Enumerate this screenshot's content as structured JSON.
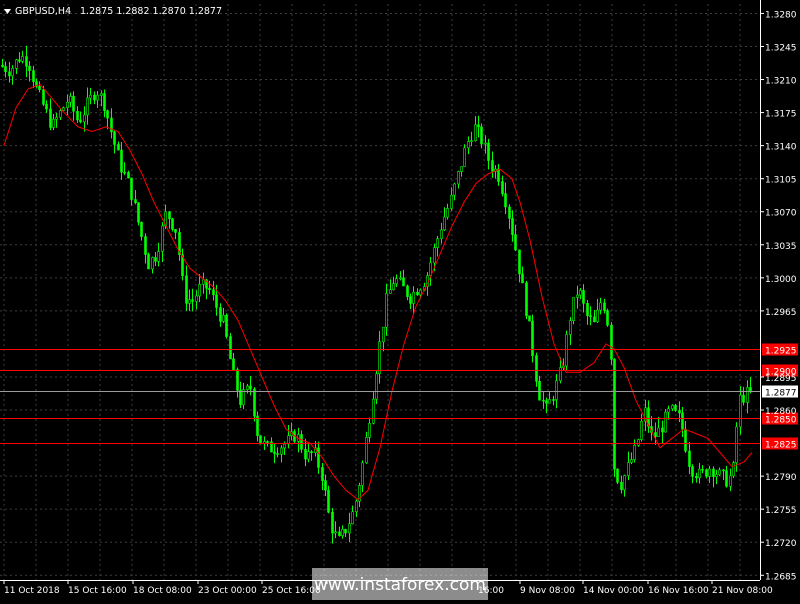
{
  "header": {
    "symbol": "GBPUSD,H4",
    "ohlc": "1.2875 1.2882 1.2870 1.2877"
  },
  "watermark": "www.instaforex.com",
  "colors": {
    "background": "#000000",
    "candle": "#00ff00",
    "ma": "#ff0000",
    "level": "#ff0000",
    "grid": "#3c3c3c",
    "axis": "#ffffff",
    "price_label_bg": "#ffffff",
    "level_label_bg": "#ff0000"
  },
  "chart_data": {
    "type": "candlestick",
    "y_ticks": [
      "1.3280",
      "1.3245",
      "1.3210",
      "1.3175",
      "1.3140",
      "1.3105",
      "1.3070",
      "1.3035",
      "1.3000",
      "1.2965",
      "1.2895",
      "1.2860",
      "1.2790",
      "1.2755",
      "1.2720",
      "1.2685"
    ],
    "ylim": [
      1.268,
      1.329
    ],
    "x_labels": [
      "11 Oct 2018",
      "15 Oct 16:00",
      "18 Oct 08:00",
      "23 Oct 00:00",
      "25 Oct 16:00",
      "16:00",
      "9 Nov 08:00",
      "14 Nov 00:00",
      "16 Nov 16:00",
      "21 Nov 08:00"
    ],
    "close_path": [
      [
        0,
        1.3225
      ],
      [
        10,
        1.322
      ],
      [
        20,
        1.3235
      ],
      [
        28,
        1.323
      ],
      [
        36,
        1.32
      ],
      [
        44,
        1.318
      ],
      [
        52,
        1.316
      ],
      [
        60,
        1.3175
      ],
      [
        68,
        1.319
      ],
      [
        78,
        1.3165
      ],
      [
        88,
        1.3185
      ],
      [
        96,
        1.32
      ],
      [
        104,
        1.3185
      ],
      [
        112,
        1.315
      ],
      [
        120,
        1.312
      ],
      [
        130,
        1.3095
      ],
      [
        140,
        1.305
      ],
      [
        148,
        1.3015
      ],
      [
        156,
        1.3025
      ],
      [
        166,
        1.307
      ],
      [
        176,
        1.305
      ],
      [
        184,
        1.298
      ],
      [
        192,
        1.2975
      ],
      [
        200,
        1.299
      ],
      [
        208,
        1.299
      ],
      [
        216,
        1.297
      ],
      [
        224,
        1.295
      ],
      [
        232,
        1.29
      ],
      [
        240,
        1.287
      ],
      [
        250,
        1.2885
      ],
      [
        258,
        1.283
      ],
      [
        266,
        1.282
      ],
      [
        276,
        1.282
      ],
      [
        286,
        1.2825
      ],
      [
        296,
        1.2835
      ],
      [
        306,
        1.281
      ],
      [
        314,
        1.2815
      ],
      [
        322,
        1.279
      ],
      [
        330,
        1.274
      ],
      [
        338,
        1.272
      ],
      [
        346,
        1.2735
      ],
      [
        354,
        1.2755
      ],
      [
        362,
        1.28
      ],
      [
        370,
        1.286
      ],
      [
        378,
        1.292
      ],
      [
        386,
        1.2975
      ],
      [
        394,
        1.3
      ],
      [
        402,
        1.299
      ],
      [
        410,
        1.298
      ],
      [
        418,
        1.299
      ],
      [
        426,
        1.3
      ],
      [
        434,
        1.303
      ],
      [
        442,
        1.306
      ],
      [
        450,
        1.308
      ],
      [
        458,
        1.311
      ],
      [
        466,
        1.314
      ],
      [
        474,
        1.316
      ],
      [
        482,
        1.3145
      ],
      [
        490,
        1.312
      ],
      [
        498,
        1.311
      ],
      [
        506,
        1.308
      ],
      [
        514,
        1.304
      ],
      [
        522,
        1.299
      ],
      [
        530,
        1.294
      ],
      [
        538,
        1.288
      ],
      [
        546,
        1.286
      ],
      [
        554,
        1.288
      ],
      [
        562,
        1.2905
      ],
      [
        570,
        1.296
      ],
      [
        578,
        1.299
      ],
      [
        586,
        1.296
      ],
      [
        594,
        1.295
      ],
      [
        602,
        1.298
      ],
      [
        610,
        1.294
      ],
      [
        614,
        1.28
      ],
      [
        620,
        1.278
      ],
      [
        628,
        1.28
      ],
      [
        636,
        1.282
      ],
      [
        644,
        1.286
      ],
      [
        652,
        1.283
      ],
      [
        660,
        1.284
      ],
      [
        670,
        1.286
      ],
      [
        680,
        1.285
      ],
      [
        690,
        1.28
      ],
      [
        700,
        1.279
      ],
      [
        710,
        1.28
      ],
      [
        720,
        1.279
      ],
      [
        728,
        1.2785
      ],
      [
        734,
        1.28
      ],
      [
        738,
        1.287
      ],
      [
        746,
        1.2877
      ],
      [
        752,
        1.2877
      ]
    ],
    "ma_path": [
      [
        4,
        1.314
      ],
      [
        16,
        1.318
      ],
      [
        28,
        1.32
      ],
      [
        40,
        1.3205
      ],
      [
        52,
        1.319
      ],
      [
        64,
        1.3175
      ],
      [
        78,
        1.316
      ],
      [
        92,
        1.3155
      ],
      [
        106,
        1.316
      ],
      [
        118,
        1.3155
      ],
      [
        130,
        1.3135
      ],
      [
        142,
        1.311
      ],
      [
        154,
        1.308
      ],
      [
        166,
        1.3055
      ],
      [
        178,
        1.303
      ],
      [
        190,
        1.301
      ],
      [
        202,
        1.3
      ],
      [
        214,
        1.299
      ],
      [
        226,
        1.2975
      ],
      [
        238,
        1.2955
      ],
      [
        250,
        1.2925
      ],
      [
        262,
        1.2895
      ],
      [
        274,
        1.2865
      ],
      [
        286,
        1.284
      ],
      [
        298,
        1.283
      ],
      [
        310,
        1.2825
      ],
      [
        322,
        1.281
      ],
      [
        334,
        1.279
      ],
      [
        346,
        1.2775
      ],
      [
        358,
        1.2765
      ],
      [
        368,
        1.2775
      ],
      [
        380,
        1.282
      ],
      [
        392,
        1.288
      ],
      [
        404,
        1.293
      ],
      [
        416,
        1.297
      ],
      [
        428,
        1.2995
      ],
      [
        440,
        1.3025
      ],
      [
        452,
        1.3055
      ],
      [
        464,
        1.308
      ],
      [
        476,
        1.31
      ],
      [
        488,
        1.311
      ],
      [
        500,
        1.3115
      ],
      [
        512,
        1.3105
      ],
      [
        520,
        1.308
      ],
      [
        530,
        1.304
      ],
      [
        542,
        1.298
      ],
      [
        554,
        1.293
      ],
      [
        566,
        1.29
      ],
      [
        580,
        1.29
      ],
      [
        594,
        1.291
      ],
      [
        606,
        1.293
      ],
      [
        614,
        1.2925
      ],
      [
        624,
        1.2905
      ],
      [
        636,
        1.287
      ],
      [
        648,
        1.2845
      ],
      [
        660,
        1.282
      ],
      [
        672,
        1.283
      ],
      [
        684,
        1.284
      ],
      [
        696,
        1.2835
      ],
      [
        708,
        1.283
      ],
      [
        720,
        1.2815
      ],
      [
        732,
        1.28
      ],
      [
        744,
        1.2805
      ],
      [
        752,
        1.2815
      ]
    ],
    "levels": [
      {
        "label": "1.2925",
        "value": 1.2925
      },
      {
        "label": "1.2900",
        "value": 1.2902
      },
      {
        "label": "1.2850",
        "value": 1.2852
      },
      {
        "label": "1.2825",
        "value": 1.2825
      }
    ],
    "current_price": {
      "label": "1.2877",
      "value": 1.288
    }
  }
}
